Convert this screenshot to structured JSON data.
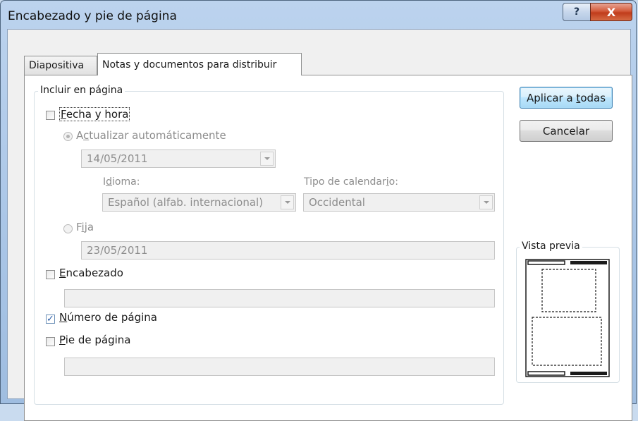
{
  "window": {
    "title": "Encabezado y pie de página",
    "help_symbol": "?",
    "close_symbol": "X"
  },
  "tabs": [
    {
      "label": "Diapositiva",
      "active": false
    },
    {
      "label": "Notas y documentos para distribuir",
      "active": true
    }
  ],
  "include": {
    "group_title": "Incluir en página",
    "date_time": {
      "label_u": "F",
      "label_rest": "echa y hora",
      "checked": false,
      "auto_update": {
        "label_a": "A",
        "label_u": "c",
        "label_rest": "tualizar automáticamente",
        "selected": true
      },
      "date_value": "14/05/2011",
      "language": {
        "label_a": "I",
        "label_u": "d",
        "label_rest": "ioma:",
        "value": "Español (alfab. internacional)"
      },
      "calendar": {
        "label_a": "Tipo de calendar",
        "label_u": "i",
        "label_rest": "o:",
        "value": "Occidental"
      },
      "fixed": {
        "label_a": "F",
        "label_u": "i",
        "label_rest": "ja",
        "selected": false,
        "value": "23/05/2011"
      }
    },
    "header": {
      "label_u": "E",
      "label_rest": "ncabezado",
      "checked": false,
      "value": ""
    },
    "page_number": {
      "label_u": "N",
      "label_rest": "úmero de página",
      "checked": true
    },
    "footer": {
      "label_u": "P",
      "label_rest": "ie de página",
      "checked": false,
      "value": ""
    }
  },
  "buttons": {
    "apply_all_a": "Aplicar a ",
    "apply_all_u": "t",
    "apply_all_rest": "odas",
    "cancel": "Cancelar"
  },
  "preview": {
    "title": "Vista previa"
  },
  "colors": {
    "accent": "#3c7fb1",
    "check": "#2c5da8",
    "close": "#c03c1b"
  }
}
